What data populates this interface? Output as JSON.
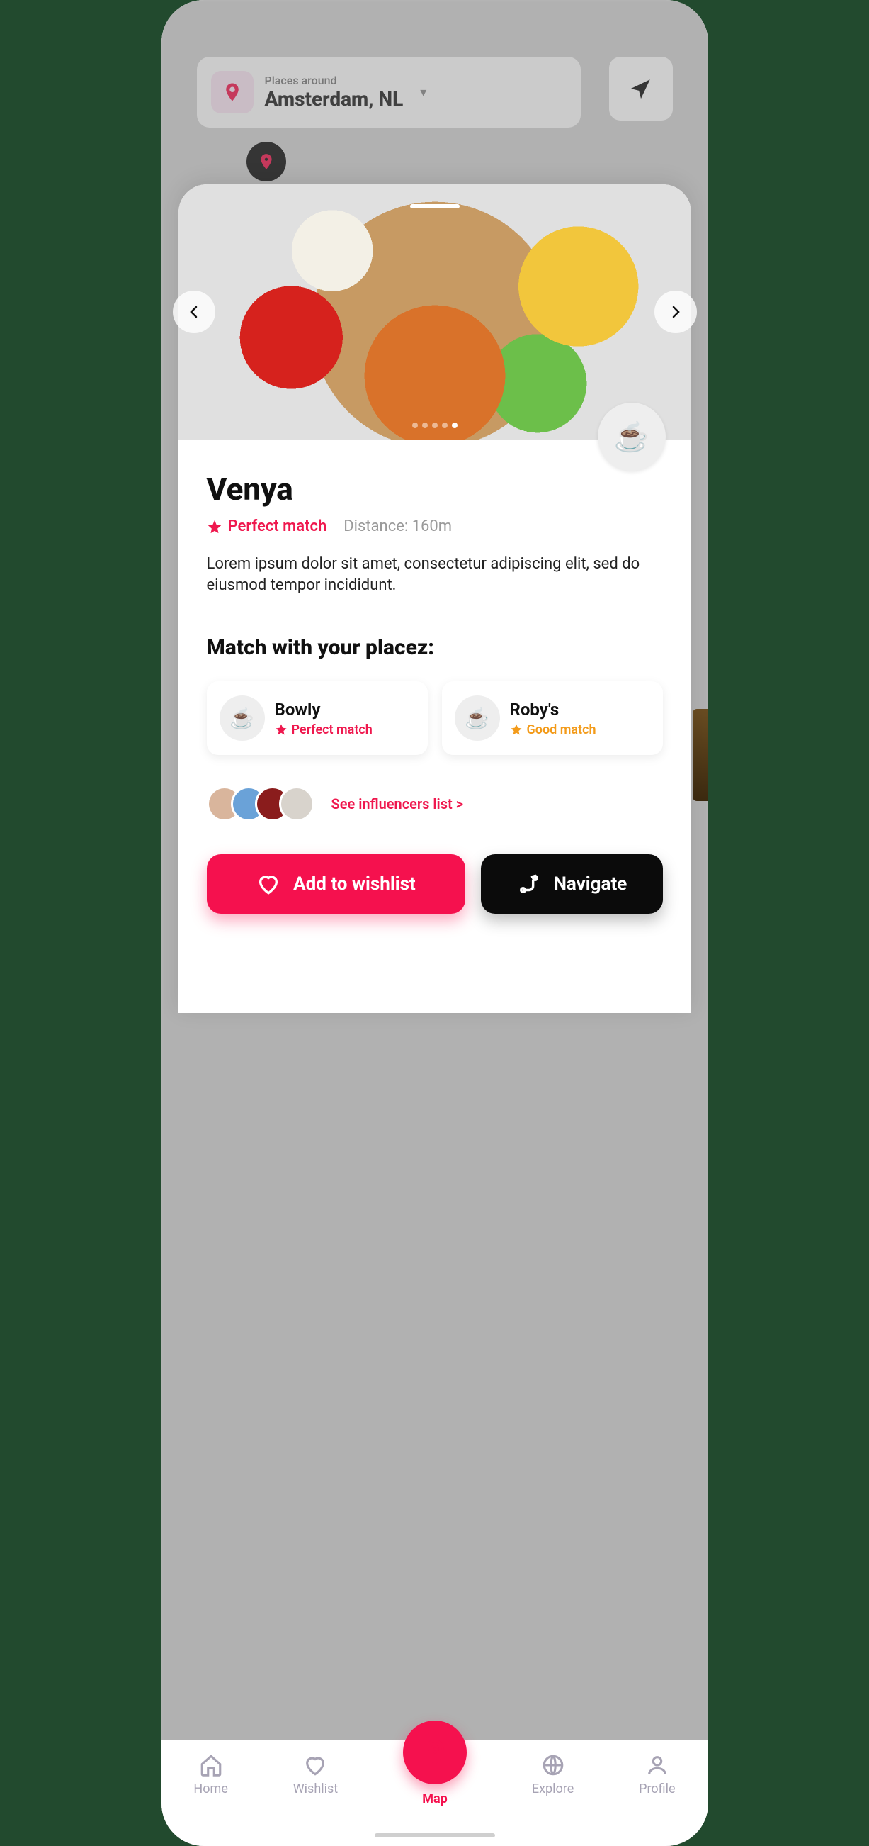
{
  "header": {
    "label": "Places around",
    "city": "Amsterdam, NL"
  },
  "place": {
    "name": "Venya",
    "match_label": "Perfect match",
    "distance_label": "Distance: 160m",
    "description": "Lorem ipsum dolor sit amet, consectetur adipiscing elit, sed do eiusmod tempor incididunt.",
    "category_emoji": "☕"
  },
  "matches_section_title": "Match with your placez:",
  "matches": [
    {
      "name": "Bowly",
      "emoji": "☕",
      "match_label": "Perfect match",
      "level": "perfect"
    },
    {
      "name": "Roby's",
      "emoji": "☕",
      "match_label": "Good match",
      "level": "good"
    }
  ],
  "influencers_link": "See influencers list >",
  "actions": {
    "wishlist": "Add to wishlist",
    "navigate": "Navigate"
  },
  "tabs": {
    "home": "Home",
    "wishlist": "Wishlist",
    "map": "Map",
    "explore": "Explore",
    "profile": "Profile"
  }
}
